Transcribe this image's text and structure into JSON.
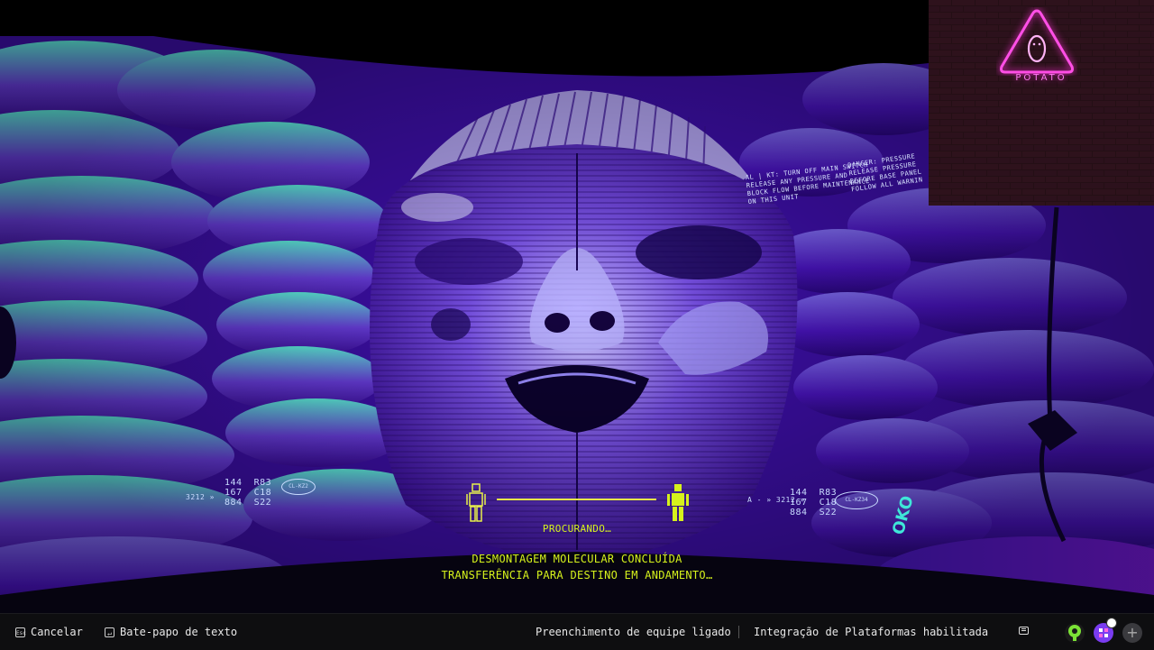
{
  "overlay": {
    "brand": "POTATO",
    "brand_color": "#ff4fe6"
  },
  "hud": {
    "left_codes": "144  R83\n167  C18\n884  S22",
    "left_prefix": "3212 »",
    "left_tag": "CL-KZ2",
    "right_codes": "144  R83\n167  C18\n884  S22",
    "right_prefix": "A - » 3212 »",
    "right_tag": "CL-KZ34",
    "oko": "OKO",
    "sign_left": "AL | KT: TURN OFF MAIN SWITCH\nRELEASE ANY PRESSURE AND\nBLOCK FLOW BEFORE MAINTENANCE\nON THIS UNIT",
    "sign_right": "DANGER: PRESSURE\nRELEASE PRESSURE\nBEFORE BASE PANEL\nFOLLOW ALL WARNIN"
  },
  "status": {
    "searching": "PROCURANDO…",
    "line1": "DESMONTAGEM MOLECULAR CONCLUÍDA",
    "line2": "TRANSFERÊNCIA PARA DESTINO EM ANDAMENTO…"
  },
  "bottombar": {
    "cancel_key": "Esc",
    "cancel_label": "Cancelar",
    "chat_key": "↵",
    "chat_label": "Bate-papo de texto",
    "squad_fill": "Preenchimento de equipe ligado",
    "crossplay": "Integração de Plataformas habilitada"
  },
  "colors": {
    "accent_yellow": "#d6f21c",
    "scene_purple": "#5a10c8",
    "scene_cyan": "#3fe6d8"
  }
}
